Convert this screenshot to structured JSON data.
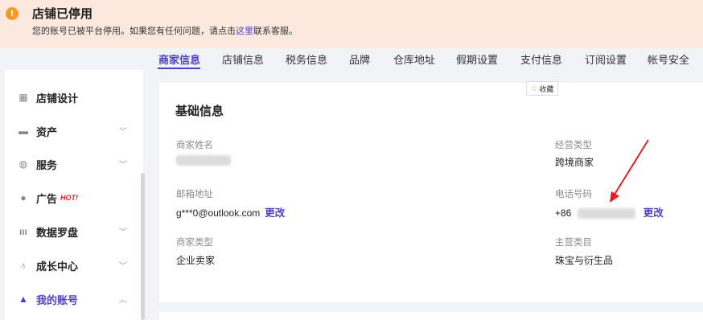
{
  "banner": {
    "icon": "exclamation-icon",
    "title": "店铺已停用",
    "desc_prefix": "您的账号已被平台停用。如果您有任何问题，请点击",
    "desc_link": "这里",
    "desc_suffix": "联系客服。"
  },
  "sidebar": {
    "items": [
      {
        "label": "店铺设计",
        "icon": "store-icon"
      },
      {
        "label": "资产",
        "icon": "card-icon"
      },
      {
        "label": "服务",
        "icon": "globe-icon"
      },
      {
        "label": "广告",
        "icon": "ad-icon",
        "badge": "HOT!"
      },
      {
        "label": "数据罗盘",
        "icon": "bar-chart-icon"
      },
      {
        "label": "成长中心",
        "icon": "medal-icon"
      },
      {
        "label": "我的账号",
        "icon": "user-icon"
      }
    ]
  },
  "tabs": [
    "商家信息",
    "店铺信息",
    "税务信息",
    "品牌",
    "仓库地址",
    "假期设置",
    "支付信息",
    "订阅设置",
    "帐号安全"
  ],
  "card": {
    "title": "基础信息",
    "fav_label": "收藏",
    "fields": {
      "merchant_name_label": "商家姓名",
      "email_label": "邮箱地址",
      "email_value": "g***0@outlook.com",
      "merchant_type_label": "商家类型",
      "merchant_type_value": "企业卖家",
      "business_type_label": "经营类型",
      "business_type_value": "跨境商家",
      "phone_label": "电话号码",
      "phone_prefix": "+86",
      "main_category_label": "主营类目",
      "main_category_value": "珠宝与衍生品",
      "edit_label": "更改"
    }
  },
  "colors": {
    "accent": "#4d3fc9",
    "banner_bg": "#fbe9e0",
    "annotation_arrow": "#e02020"
  }
}
